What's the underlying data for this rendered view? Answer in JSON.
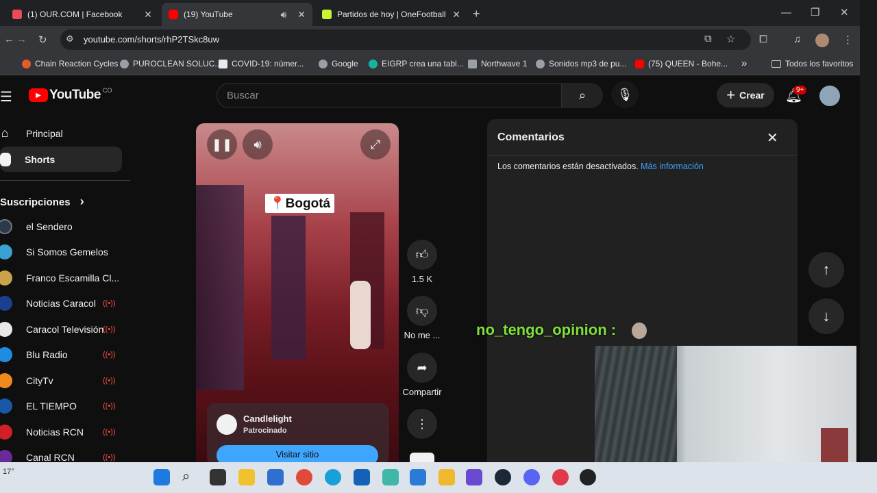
{
  "tabs": [
    {
      "title": "(1) OUR.COM | Facebook",
      "color": "#e94b5a"
    },
    {
      "title": "(19) YouTube",
      "color": "#ff0000"
    },
    {
      "title": "Partidos de hoy | OneFootball",
      "color": "#c6f432"
    }
  ],
  "address": {
    "url": "youtube.com/shorts/rhP2TSkc8uw"
  },
  "bookmarks": [
    {
      "label": "Chain Reaction Cycles",
      "color": "#e25b2b"
    },
    {
      "label": "PUROCLEAN SOLUC...",
      "color": "#9aa0a6"
    },
    {
      "label": "COVID-19: númer...",
      "color": "#e8eaed"
    },
    {
      "label": "Google",
      "color": "#9aa0a6"
    },
    {
      "label": "EIGRP crea una tabl...",
      "color": "#16b3a3"
    },
    {
      "label": "Northwave 1",
      "color": "#9aa0a6"
    },
    {
      "label": "Sonidos mp3 de pu...",
      "color": "#9aa0a6"
    },
    {
      "label": "(75) QUEEN - Bohe...",
      "color": "#ff0000"
    }
  ],
  "bookmarks_more": "»",
  "bookmarks_all": "Todos los favoritos",
  "youtube": {
    "logo": "YouTube",
    "country": "CO",
    "search_placeholder": "Buscar",
    "create_label": "Crear",
    "notif_badge": "9+"
  },
  "sidebar": {
    "home": "Principal",
    "shorts": "Shorts",
    "subs_header": "Suscripciones",
    "subs_chevron": "›",
    "channels": [
      {
        "name": "el Sendero",
        "color": "#2b3b4b",
        "live": false
      },
      {
        "name": "Si Somos Gemelos",
        "color": "#3aa0d0",
        "live": false
      },
      {
        "name": "Franco Escamilla Cl...",
        "color": "#c9a24a",
        "live": false
      },
      {
        "name": "Noticias Caracol",
        "color": "#1a3f8f",
        "live": true
      },
      {
        "name": "Caracol Televisión",
        "color": "#e8e8e8",
        "live": true
      },
      {
        "name": "Blu Radio",
        "color": "#1e8de0",
        "live": true
      },
      {
        "name": "CityTv",
        "color": "#f08a1c",
        "live": true
      },
      {
        "name": "EL TIEMPO",
        "color": "#1758a8",
        "live": true
      },
      {
        "name": "Noticias RCN",
        "color": "#d21f26",
        "live": true
      },
      {
        "name": "Canal RCN",
        "color": "#6a2a9a",
        "live": true
      }
    ],
    "live_icon": "((•))"
  },
  "short": {
    "location_tag": "📍Bogotá",
    "ad_channel": "Candlelight",
    "ad_sponsored": "Patrocinado",
    "ad_button": "Visitar sitio",
    "like_count": "1.5 K",
    "dislike_label": "No me ...",
    "share_label": "Compartir"
  },
  "comments": {
    "title": "Comentarios",
    "disabled_text": "Los comentarios están desactivados.",
    "more_info": "Más información"
  },
  "overlay": {
    "username": "no_tengo_opinion :"
  },
  "taskbar": {
    "weather": "17°"
  }
}
